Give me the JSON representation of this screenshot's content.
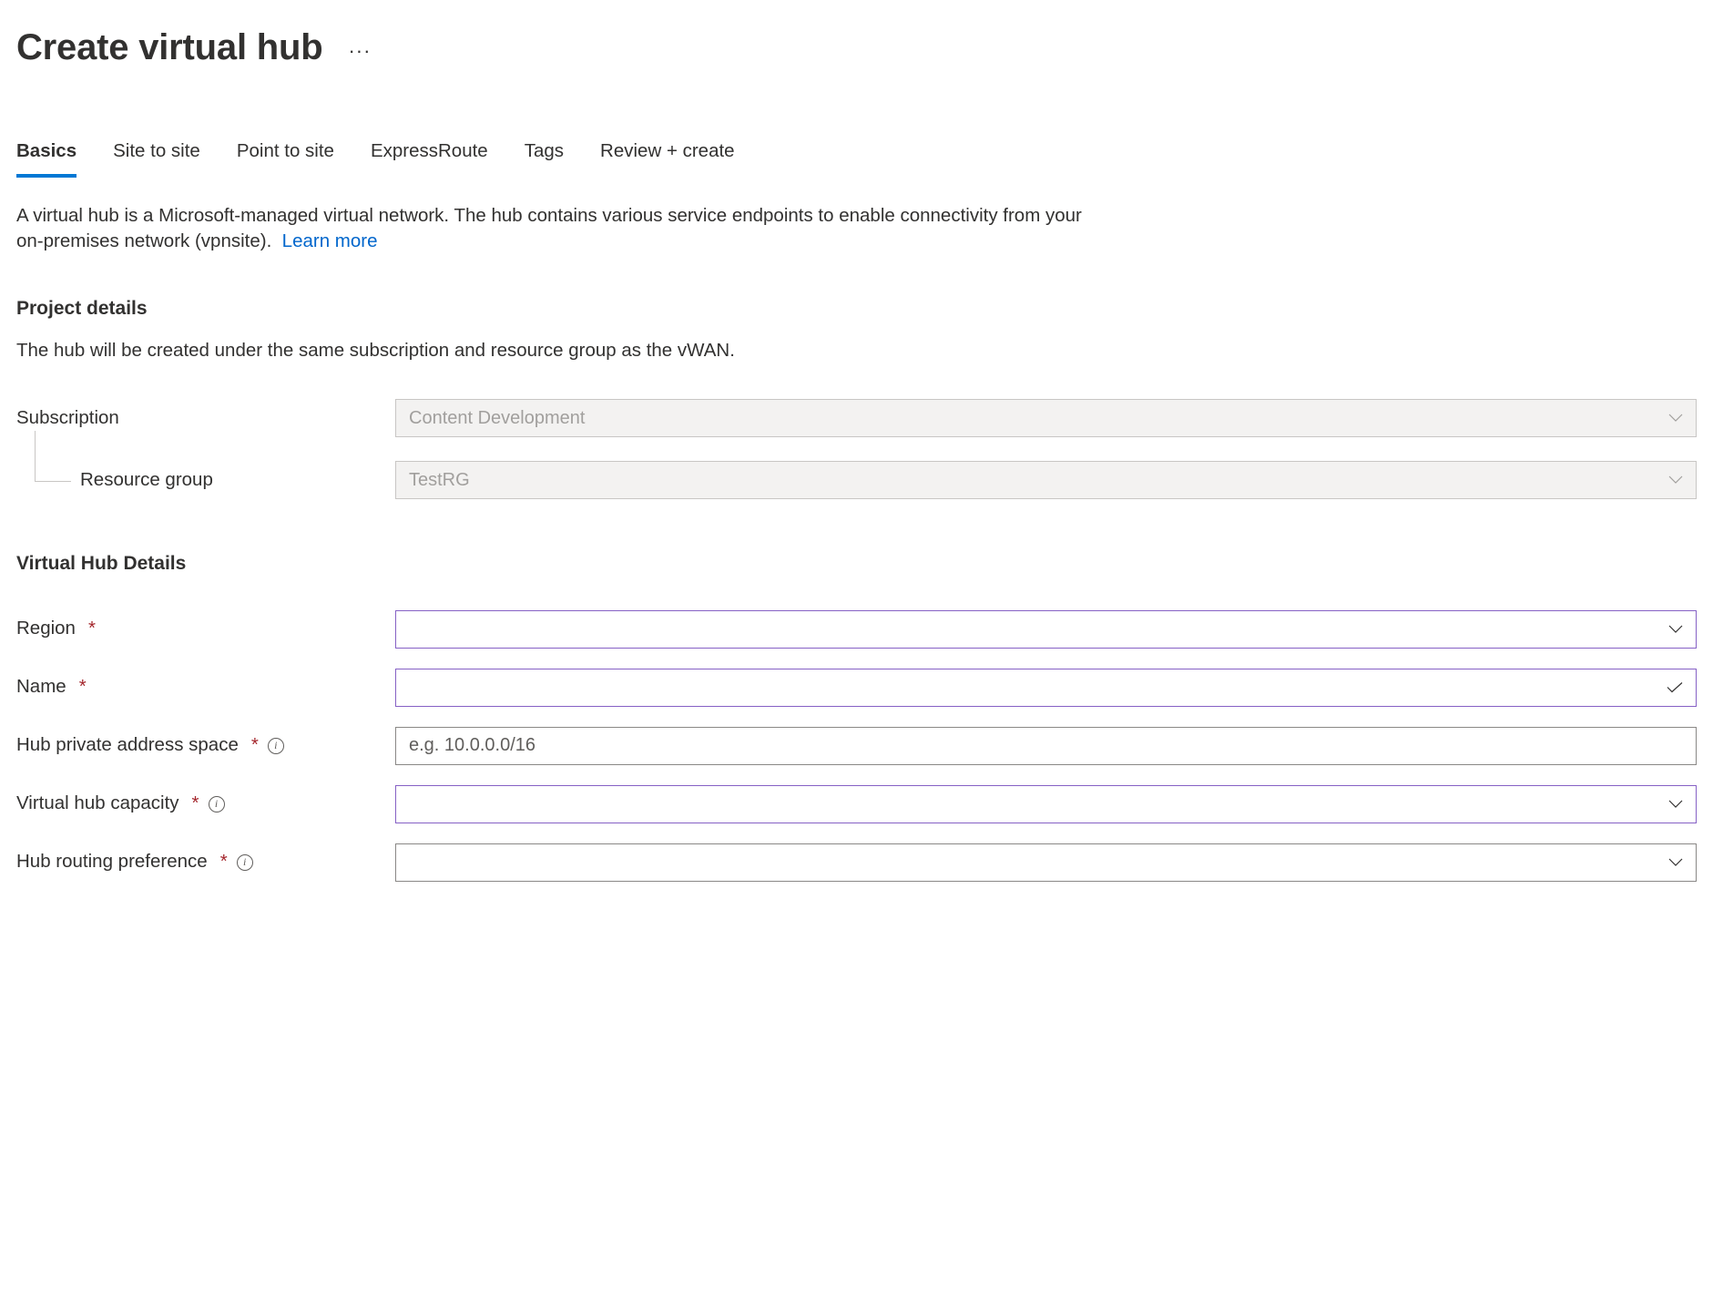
{
  "header": {
    "title": "Create virtual hub"
  },
  "tabs": [
    {
      "label": "Basics",
      "active": true
    },
    {
      "label": "Site to site",
      "active": false
    },
    {
      "label": "Point to site",
      "active": false
    },
    {
      "label": "ExpressRoute",
      "active": false
    },
    {
      "label": "Tags",
      "active": false
    },
    {
      "label": "Review + create",
      "active": false
    }
  ],
  "description": {
    "text": "A virtual hub is a Microsoft-managed virtual network. The hub contains various service endpoints to enable connectivity from your on-premises network (vpnsite).",
    "learn_more": "Learn more"
  },
  "sections": {
    "project_details": {
      "heading": "Project details",
      "subtext": "The hub will be created under the same subscription and resource group as the vWAN.",
      "fields": {
        "subscription": {
          "label": "Subscription",
          "value": "Content Development"
        },
        "resource_group": {
          "label": "Resource group",
          "value": "TestRG"
        }
      }
    },
    "vhub_details": {
      "heading": "Virtual Hub Details",
      "fields": {
        "region": {
          "label": "Region",
          "value": ""
        },
        "name": {
          "label": "Name",
          "value": ""
        },
        "address_space": {
          "label": "Hub private address space",
          "placeholder": "e.g. 10.0.0.0/16",
          "value": ""
        },
        "capacity": {
          "label": "Virtual hub capacity",
          "value": ""
        },
        "routing_pref": {
          "label": "Hub routing preference",
          "value": ""
        }
      }
    }
  }
}
